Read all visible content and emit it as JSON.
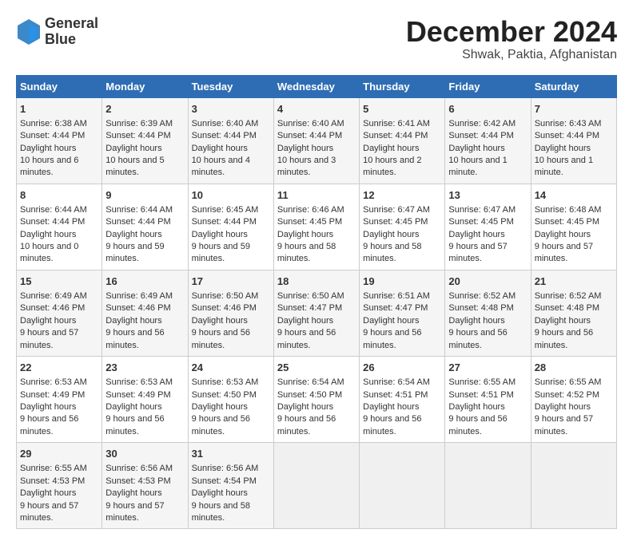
{
  "header": {
    "logo_line1": "General",
    "logo_line2": "Blue",
    "month_title": "December 2024",
    "location": "Shwak, Paktia, Afghanistan"
  },
  "days_of_week": [
    "Sunday",
    "Monday",
    "Tuesday",
    "Wednesday",
    "Thursday",
    "Friday",
    "Saturday"
  ],
  "weeks": [
    [
      {
        "day": "1",
        "sunrise": "6:38 AM",
        "sunset": "4:44 PM",
        "daylight": "10 hours and 6 minutes."
      },
      {
        "day": "2",
        "sunrise": "6:39 AM",
        "sunset": "4:44 PM",
        "daylight": "10 hours and 5 minutes."
      },
      {
        "day": "3",
        "sunrise": "6:40 AM",
        "sunset": "4:44 PM",
        "daylight": "10 hours and 4 minutes."
      },
      {
        "day": "4",
        "sunrise": "6:40 AM",
        "sunset": "4:44 PM",
        "daylight": "10 hours and 3 minutes."
      },
      {
        "day": "5",
        "sunrise": "6:41 AM",
        "sunset": "4:44 PM",
        "daylight": "10 hours and 2 minutes."
      },
      {
        "day": "6",
        "sunrise": "6:42 AM",
        "sunset": "4:44 PM",
        "daylight": "10 hours and 1 minute."
      },
      {
        "day": "7",
        "sunrise": "6:43 AM",
        "sunset": "4:44 PM",
        "daylight": "10 hours and 1 minute."
      }
    ],
    [
      {
        "day": "8",
        "sunrise": "6:44 AM",
        "sunset": "4:44 PM",
        "daylight": "10 hours and 0 minutes."
      },
      {
        "day": "9",
        "sunrise": "6:44 AM",
        "sunset": "4:44 PM",
        "daylight": "9 hours and 59 minutes."
      },
      {
        "day": "10",
        "sunrise": "6:45 AM",
        "sunset": "4:44 PM",
        "daylight": "9 hours and 59 minutes."
      },
      {
        "day": "11",
        "sunrise": "6:46 AM",
        "sunset": "4:45 PM",
        "daylight": "9 hours and 58 minutes."
      },
      {
        "day": "12",
        "sunrise": "6:47 AM",
        "sunset": "4:45 PM",
        "daylight": "9 hours and 58 minutes."
      },
      {
        "day": "13",
        "sunrise": "6:47 AM",
        "sunset": "4:45 PM",
        "daylight": "9 hours and 57 minutes."
      },
      {
        "day": "14",
        "sunrise": "6:48 AM",
        "sunset": "4:45 PM",
        "daylight": "9 hours and 57 minutes."
      }
    ],
    [
      {
        "day": "15",
        "sunrise": "6:49 AM",
        "sunset": "4:46 PM",
        "daylight": "9 hours and 57 minutes."
      },
      {
        "day": "16",
        "sunrise": "6:49 AM",
        "sunset": "4:46 PM",
        "daylight": "9 hours and 56 minutes."
      },
      {
        "day": "17",
        "sunrise": "6:50 AM",
        "sunset": "4:46 PM",
        "daylight": "9 hours and 56 minutes."
      },
      {
        "day": "18",
        "sunrise": "6:50 AM",
        "sunset": "4:47 PM",
        "daylight": "9 hours and 56 minutes."
      },
      {
        "day": "19",
        "sunrise": "6:51 AM",
        "sunset": "4:47 PM",
        "daylight": "9 hours and 56 minutes."
      },
      {
        "day": "20",
        "sunrise": "6:52 AM",
        "sunset": "4:48 PM",
        "daylight": "9 hours and 56 minutes."
      },
      {
        "day": "21",
        "sunrise": "6:52 AM",
        "sunset": "4:48 PM",
        "daylight": "9 hours and 56 minutes."
      }
    ],
    [
      {
        "day": "22",
        "sunrise": "6:53 AM",
        "sunset": "4:49 PM",
        "daylight": "9 hours and 56 minutes."
      },
      {
        "day": "23",
        "sunrise": "6:53 AM",
        "sunset": "4:49 PM",
        "daylight": "9 hours and 56 minutes."
      },
      {
        "day": "24",
        "sunrise": "6:53 AM",
        "sunset": "4:50 PM",
        "daylight": "9 hours and 56 minutes."
      },
      {
        "day": "25",
        "sunrise": "6:54 AM",
        "sunset": "4:50 PM",
        "daylight": "9 hours and 56 minutes."
      },
      {
        "day": "26",
        "sunrise": "6:54 AM",
        "sunset": "4:51 PM",
        "daylight": "9 hours and 56 minutes."
      },
      {
        "day": "27",
        "sunrise": "6:55 AM",
        "sunset": "4:51 PM",
        "daylight": "9 hours and 56 minutes."
      },
      {
        "day": "28",
        "sunrise": "6:55 AM",
        "sunset": "4:52 PM",
        "daylight": "9 hours and 57 minutes."
      }
    ],
    [
      {
        "day": "29",
        "sunrise": "6:55 AM",
        "sunset": "4:53 PM",
        "daylight": "9 hours and 57 minutes."
      },
      {
        "day": "30",
        "sunrise": "6:56 AM",
        "sunset": "4:53 PM",
        "daylight": "9 hours and 57 minutes."
      },
      {
        "day": "31",
        "sunrise": "6:56 AM",
        "sunset": "4:54 PM",
        "daylight": "9 hours and 58 minutes."
      },
      {
        "day": "",
        "sunrise": "",
        "sunset": "",
        "daylight": ""
      },
      {
        "day": "",
        "sunrise": "",
        "sunset": "",
        "daylight": ""
      },
      {
        "day": "",
        "sunrise": "",
        "sunset": "",
        "daylight": ""
      },
      {
        "day": "",
        "sunrise": "",
        "sunset": "",
        "daylight": ""
      }
    ]
  ]
}
